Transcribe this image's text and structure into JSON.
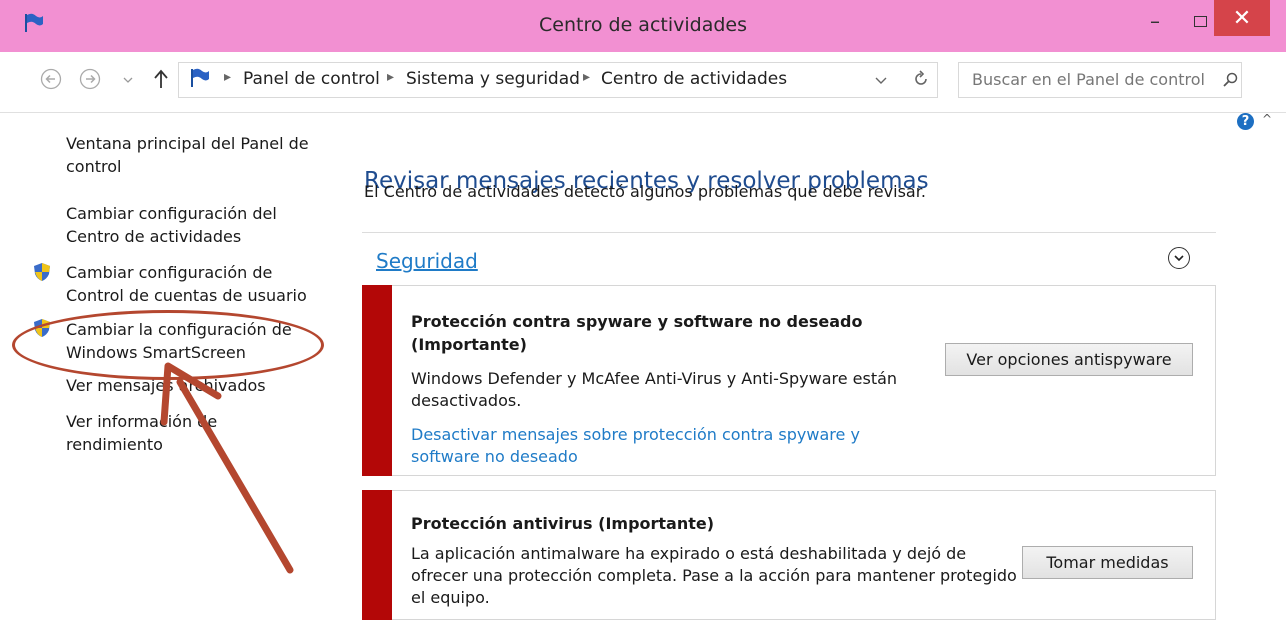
{
  "window": {
    "title": "Centro de actividades",
    "minimize": "–",
    "maximize": "☐",
    "close": "✕"
  },
  "nav": {
    "breadcrumbs": [
      "Panel de control",
      "Sistema y seguridad",
      "Centro de actividades"
    ],
    "search_placeholder": "Buscar en el Panel de control"
  },
  "sidebar": {
    "items": [
      {
        "label": "Ventana principal del Panel de control"
      },
      {
        "label": "Cambiar configuración del Centro de actividades"
      },
      {
        "label": "Cambiar configuración de Control de cuentas de usuario"
      },
      {
        "label": "Cambiar la configuración de Windows SmartScreen"
      },
      {
        "label": "Ver mensajes archivados"
      },
      {
        "label": "Ver información de rendimiento"
      }
    ]
  },
  "main": {
    "heading": "Revisar mensajes recientes y resolver problemas",
    "subheading": "El Centro de actividades detectó algunos problemas que debe revisar.",
    "section_title": "Seguridad",
    "cards": [
      {
        "title": "Protección contra spyware y software no deseado (Importante)",
        "text": "Windows Defender y McAfee Anti-Virus y Anti-Spyware están desactivados.",
        "link": "Desactivar mensajes sobre protección contra spyware y software no deseado",
        "button": "Ver opciones antispyware"
      },
      {
        "title": "Protección antivirus (Importante)",
        "text": "La aplicación antimalware ha expirado o está deshabilitada y dejó de ofrecer una protección completa. Pase a la acción para mantener protegido el equipo.",
        "button": "Tomar medidas"
      }
    ]
  },
  "colors": {
    "titlebar": "#f290d2",
    "alert": "#b30707",
    "link": "#1f7bc7",
    "annotation": "#b4472f"
  }
}
